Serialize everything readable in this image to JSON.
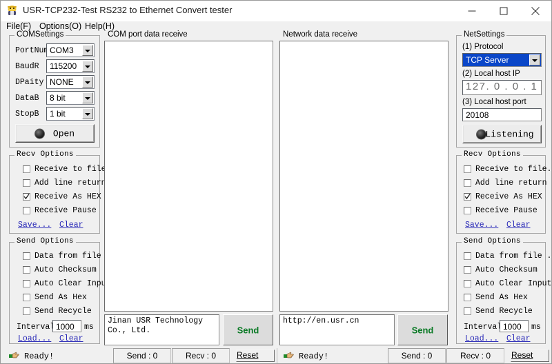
{
  "window": {
    "title": "USR-TCP232-Test  RS232 to Ethernet Convert tester",
    "icon": "app-icon",
    "minimize_label": "–",
    "maximize_label": "□",
    "close_label": "✕"
  },
  "menubar": {
    "items": [
      {
        "label": "File(F)"
      },
      {
        "label": "Options(O)"
      },
      {
        "label": "Help(H)"
      }
    ]
  },
  "com_settings": {
    "group_label": "COMSettings",
    "fields": [
      {
        "label": "PortNum",
        "value": "COM3"
      },
      {
        "label": "BaudR",
        "value": "115200"
      },
      {
        "label": "DPaity",
        "value": "NONE"
      },
      {
        "label": "DataB",
        "value": "8 bit"
      },
      {
        "label": "StopB",
        "value": "1 bit"
      }
    ],
    "open_button": "Open"
  },
  "com_recv_options": {
    "group_label": "Recv Options",
    "checkboxes": [
      {
        "label": "Receive to file...",
        "checked": false
      },
      {
        "label": "Add line return",
        "checked": false
      },
      {
        "label": "Receive As HEX",
        "checked": true
      },
      {
        "label": "Receive Pause",
        "checked": false
      }
    ],
    "save_link": "Save...",
    "clear_link": "Clear"
  },
  "com_send_options": {
    "group_label": "Send Options",
    "checkboxes": [
      {
        "label": "Data from file ...",
        "checked": false
      },
      {
        "label": "Auto Checksum",
        "checked": false
      },
      {
        "label": "Auto Clear Input",
        "checked": false
      },
      {
        "label": "Send As Hex",
        "checked": false
      },
      {
        "label": "Send Recycle",
        "checked": false
      }
    ],
    "interval_label": "Interval",
    "interval_value": "1000",
    "interval_unit": "ms",
    "load_link": "Load...",
    "clear_link": "Clear"
  },
  "com_panel": {
    "group_label": "COM port data receive",
    "receive_text": "",
    "send_text": "Jinan USR Technology Co., Ltd.",
    "send_button": "Send"
  },
  "net_panel": {
    "group_label": "Network data receive",
    "receive_text": "",
    "send_text": "http://en.usr.cn",
    "send_button": "Send"
  },
  "net_settings": {
    "group_label": "NetSettings",
    "protocol_label": "(1) Protocol",
    "protocol_value": "TCP Server",
    "host_ip_label": "(2) Local host IP",
    "host_ip_value": "127. 0  . 0  . 1",
    "host_port_label": "(3) Local host port",
    "host_port_value": "20108",
    "listen_button": "Listening"
  },
  "net_recv_options": {
    "group_label": "Recv Options",
    "checkboxes": [
      {
        "label": "Receive to file...",
        "checked": false
      },
      {
        "label": "Add line return",
        "checked": false
      },
      {
        "label": "Receive As HEX",
        "checked": true
      },
      {
        "label": "Receive Pause",
        "checked": false
      }
    ],
    "save_link": "Save...",
    "clear_link": "Clear"
  },
  "net_send_options": {
    "group_label": "Send Options",
    "checkboxes": [
      {
        "label": "Data from file ...",
        "checked": false
      },
      {
        "label": "Auto Checksum",
        "checked": false
      },
      {
        "label": "Auto Clear Input",
        "checked": false
      },
      {
        "label": "Send As Hex",
        "checked": false
      },
      {
        "label": "Send Recycle",
        "checked": false
      }
    ],
    "interval_label": "Interval",
    "interval_value": "1000",
    "interval_unit": "ms",
    "load_link": "Load...",
    "clear_link": "Clear"
  },
  "status_left": {
    "ready_text": "Ready!",
    "send_count": "Send : 0",
    "recv_count": "Recv : 0",
    "reset_label": "Reset"
  },
  "status_right": {
    "ready_text": "Ready!",
    "send_count": "Send : 0",
    "recv_count": "Recv : 0",
    "reset_label": "Reset"
  },
  "colors": {
    "selection_blue": "#0a46c8",
    "send_green": "#0b7a26",
    "link_blue": "#2b2bb8",
    "window_bg": "#f0f0f0"
  }
}
